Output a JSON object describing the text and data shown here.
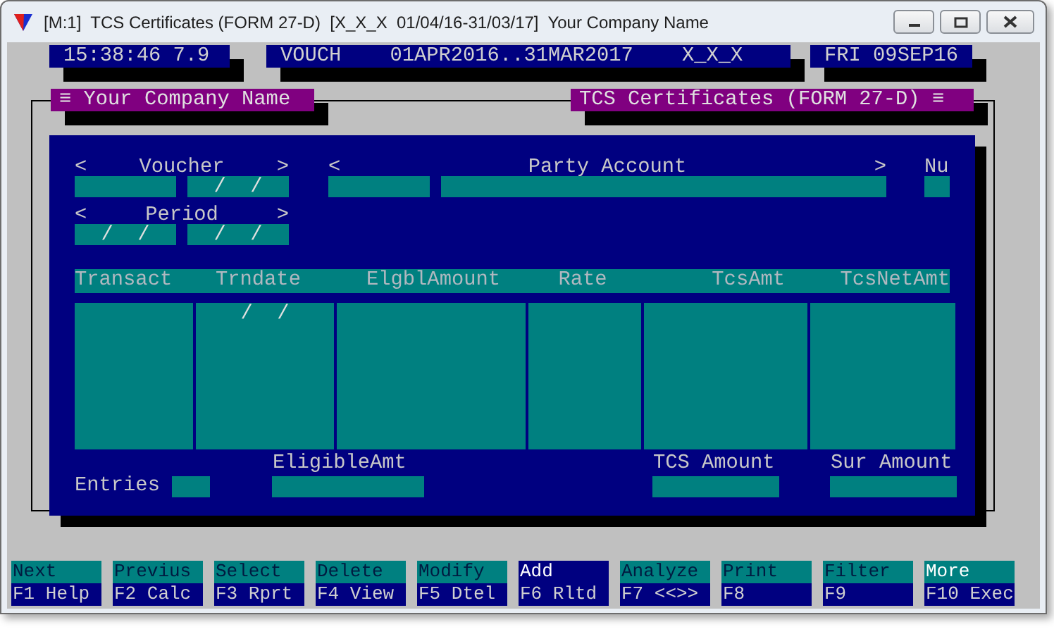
{
  "window": {
    "title": "[M:1]  TCS Certificates (FORM 27-D)  [X_X_X  01/04/16-31/03/17]  Your Company Name"
  },
  "status_bar": [
    "15:38:46 7.9",
    "VOUCH    01APR2016..31MAR2017    X_X_X",
    "FRI 09SEP16"
  ],
  "panel_tabs": [
    "≡ Your Company Name",
    "TCS Certificates (FORM 27-D) ≡"
  ],
  "filters": [
    {
      "label": "Voucher",
      "left": "<",
      "right": ">",
      "fields": [
        {
          "kind": "blank"
        },
        {
          "kind": "date",
          "value": "/  /"
        }
      ]
    },
    {
      "label": "Party Account",
      "left": "<",
      "right": ">",
      "fields": [
        {
          "kind": "blank"
        },
        {
          "kind": "blank"
        }
      ]
    },
    {
      "label": "Nu",
      "fields": [
        {
          "kind": "blank"
        }
      ]
    },
    {
      "label": "Period",
      "left": "<",
      "right": ">",
      "fields": [
        {
          "kind": "date",
          "value": "/  /"
        },
        {
          "kind": "date",
          "value": "/  /"
        }
      ]
    }
  ],
  "table": {
    "columns": [
      "Transact",
      "Trndate",
      "ElgblAmount",
      "Rate",
      "TcsAmt",
      "TcsNetAmt"
    ],
    "rows": [
      {
        "trndate": "/  /"
      }
    ]
  },
  "totals": [
    {
      "label": "Entries"
    },
    {
      "label": "EligibleAmt"
    },
    {
      "label": "TCS Amount"
    },
    {
      "label": "Sur Amount"
    }
  ],
  "keys": [
    {
      "label": "Next",
      "fkey": "F1 Help",
      "selected": false,
      "kind": "action"
    },
    {
      "label": "Previus",
      "fkey": "F2 Calc",
      "selected": false,
      "kind": "action"
    },
    {
      "label": "Select",
      "fkey": "F3 Rprt",
      "selected": false,
      "kind": "action"
    },
    {
      "label": "Delete",
      "fkey": "F4 View",
      "selected": false,
      "kind": "action"
    },
    {
      "label": "Modify",
      "fkey": "F5 Dtel",
      "selected": false,
      "kind": "action"
    },
    {
      "label": "Add",
      "fkey": "F6 Rltd",
      "selected": true,
      "kind": "action"
    },
    {
      "label": "Analyze",
      "fkey": "F7 <<>>",
      "selected": false,
      "kind": "action"
    },
    {
      "label": "Print",
      "fkey": "F8",
      "selected": false,
      "kind": "action"
    },
    {
      "label": "Filter",
      "fkey": "F9",
      "selected": false,
      "kind": "action"
    },
    {
      "label": "More",
      "fkey": "F10 Exec",
      "selected": false,
      "kind": "more"
    }
  ]
}
